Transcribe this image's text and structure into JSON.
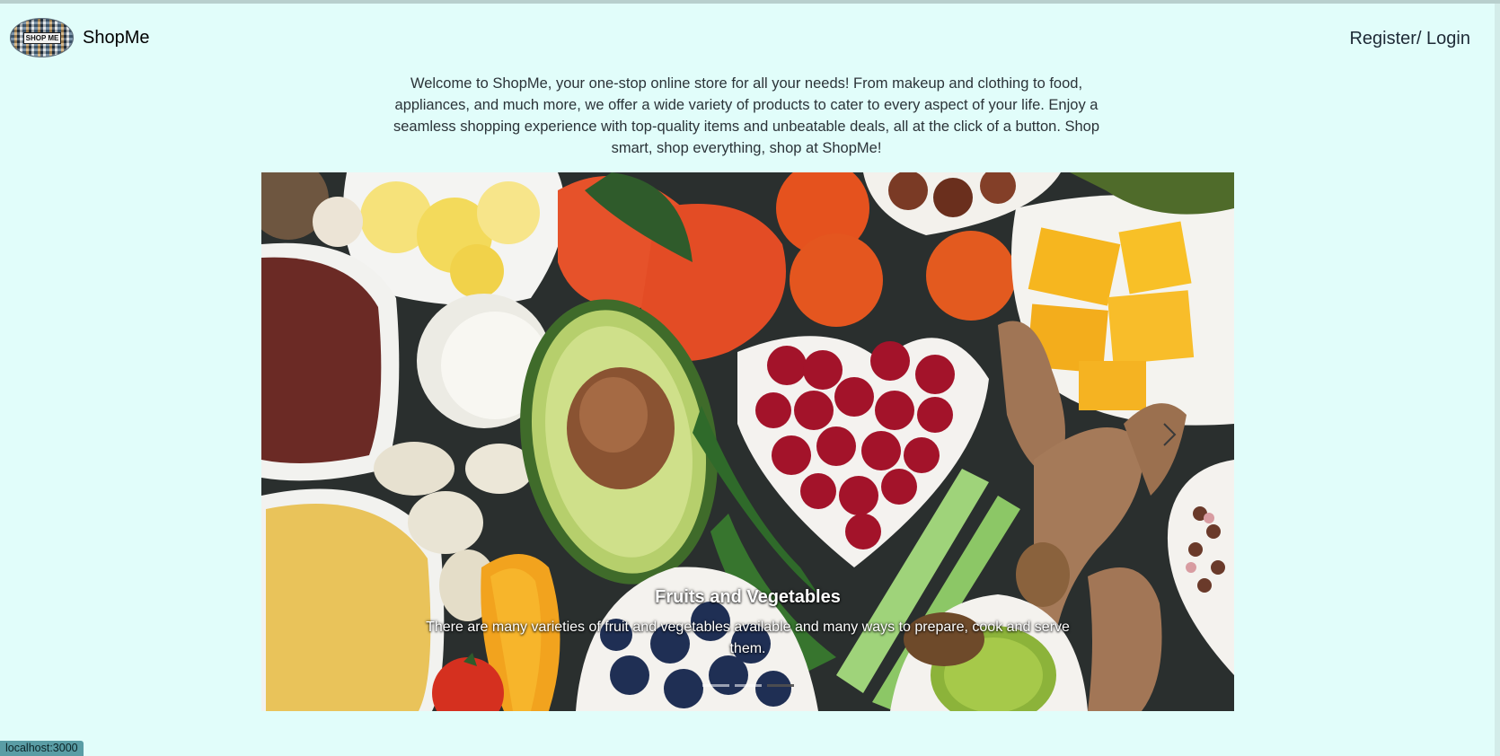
{
  "navbar": {
    "brand_name": "ShopMe",
    "logo_text": "SHOP ME",
    "login_label": "Register/ Login"
  },
  "intro": {
    "text": "Welcome to ShopMe, your one-stop online store for all your needs! From makeup and clothing to food, appliances, and much more, we offer a wide variety of products to cater to every aspect of your life. Enjoy a seamless shopping experience with top-quality items and unbeatable deals, all at the click of a button. Shop smart, shop everything, shop at ShopMe!"
  },
  "carousel": {
    "slide_image_icon": "fruits-vegetables-photo",
    "caption_title": "Fruits and Vegetables",
    "caption_text": "There are many varieties of fruit and vegetables available and many ways to prepare, cook and serve them.",
    "next_icon": "chevron-right-icon",
    "slide_count": 3,
    "active_slide": 3
  },
  "statusbar": {
    "url": "localhost:3000"
  },
  "colors": {
    "background": "#e1fdfa",
    "text": "#212529",
    "statusbar": "#5a9da5"
  }
}
